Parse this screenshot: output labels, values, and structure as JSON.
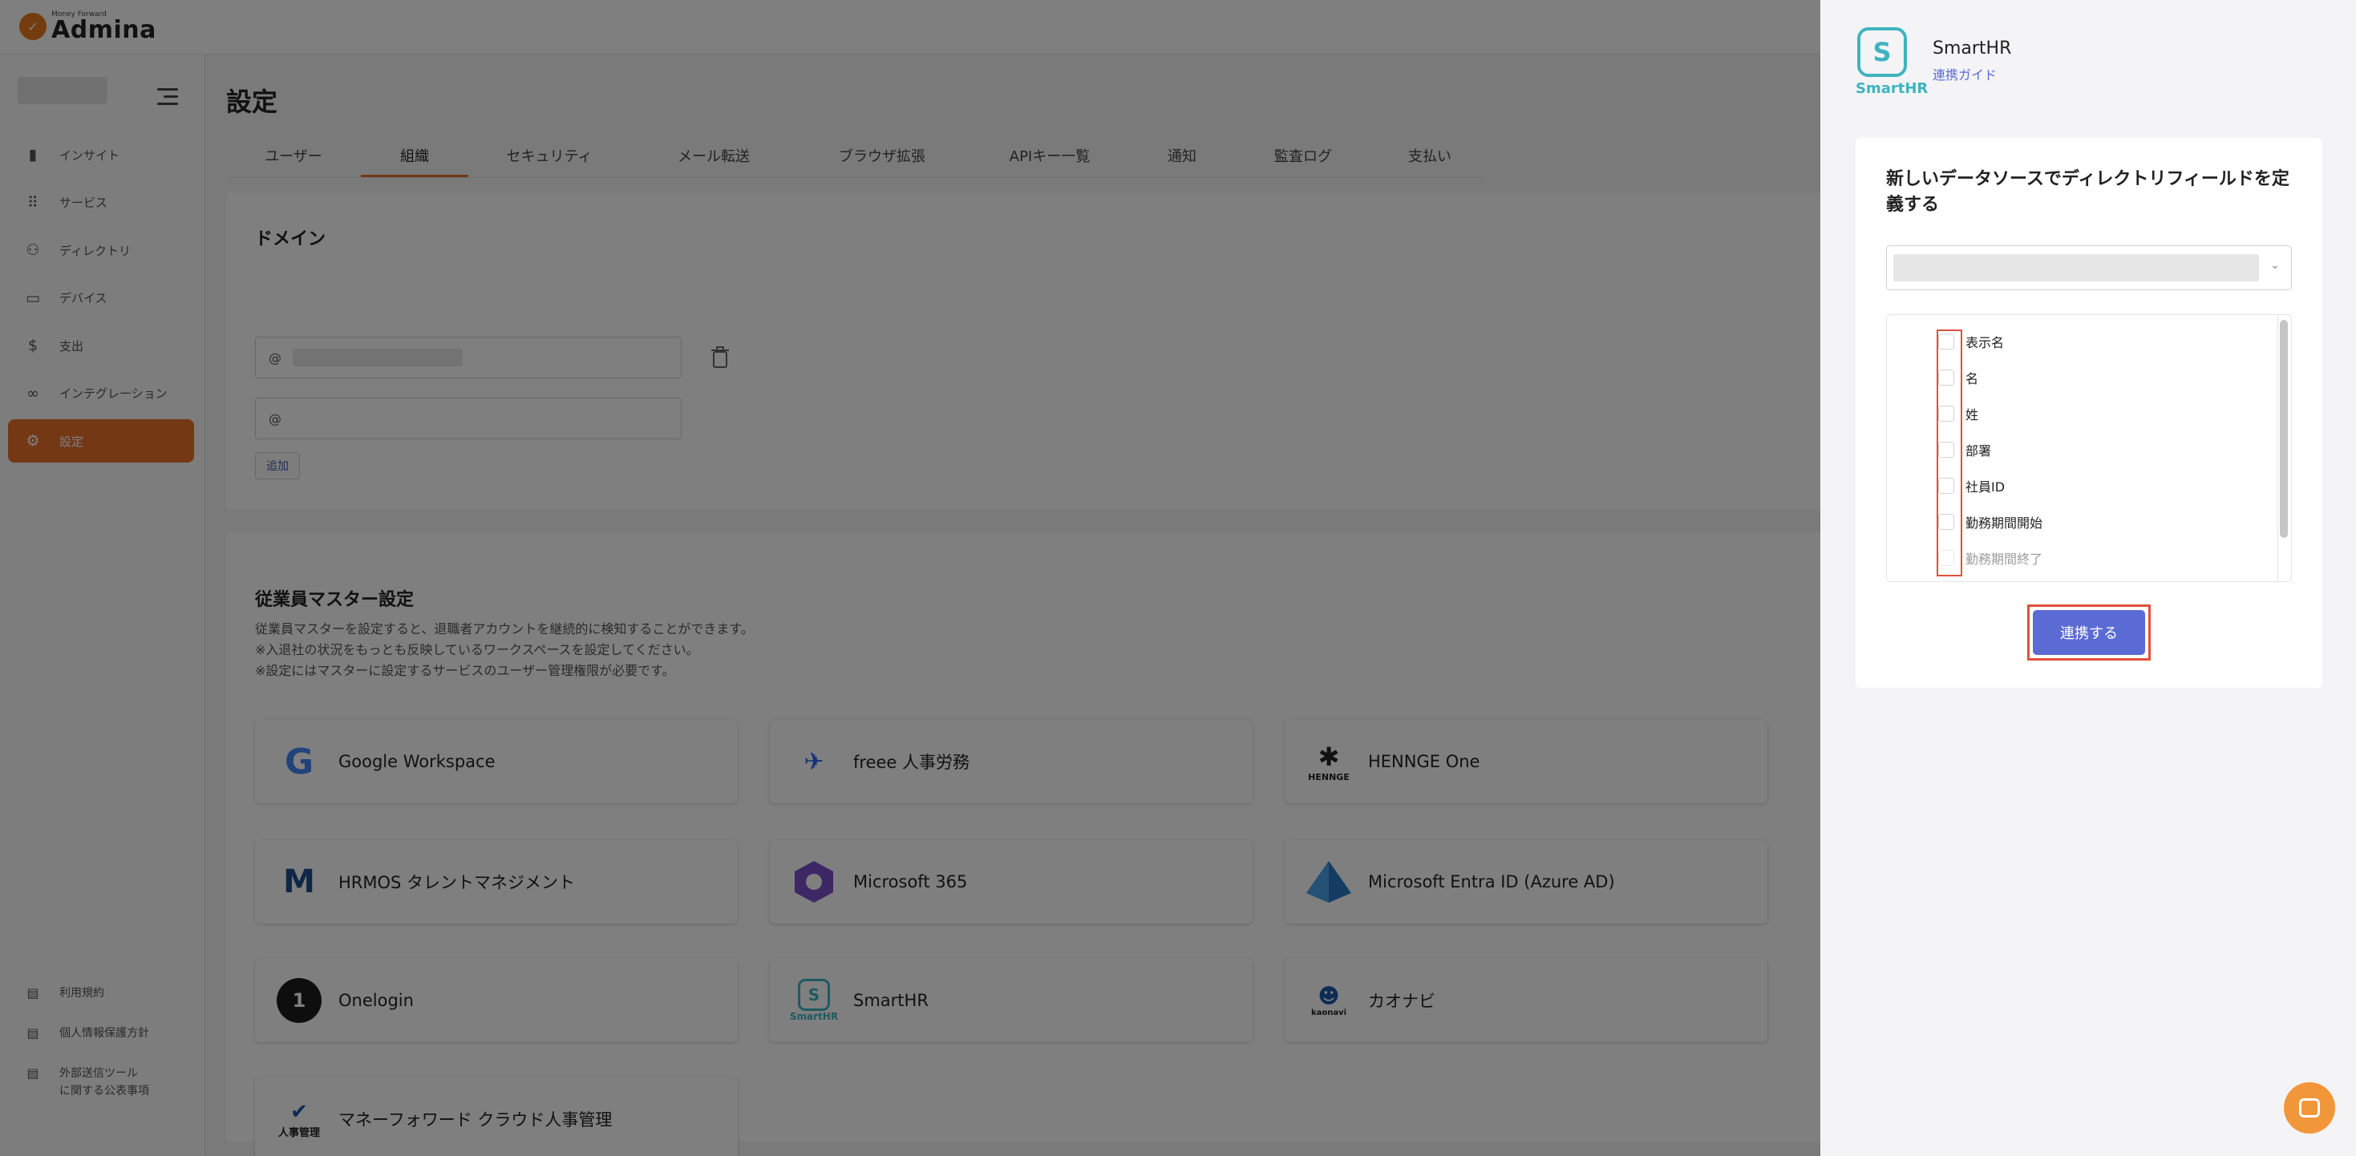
{
  "brand": {
    "sub": "Money Forward",
    "name": "Admina"
  },
  "sidebar": {
    "items": [
      {
        "label": "インサイト",
        "icon": "chart-bar-icon"
      },
      {
        "label": "サービス",
        "icon": "grid-icon"
      },
      {
        "label": "ディレクトリ",
        "icon": "users-icon"
      },
      {
        "label": "デバイス",
        "icon": "laptop-icon"
      },
      {
        "label": "支出",
        "icon": "dollar-icon"
      },
      {
        "label": "インテグレーション",
        "icon": "link-icon"
      },
      {
        "label": "設定",
        "icon": "gear-icon",
        "active": true
      }
    ],
    "footer": [
      {
        "label": "利用規約",
        "icon": "document-icon"
      },
      {
        "label": "個人情報保護方針",
        "icon": "document-icon"
      },
      {
        "label": "外部送信ツール\nに関する公表事項",
        "icon": "document-icon"
      }
    ]
  },
  "main": {
    "title": "設定",
    "tabs": [
      "ユーザー",
      "組織",
      "セキュリティ",
      "メール転送",
      "ブラウザ拡張",
      "APIキー一覧",
      "通知",
      "監査ログ",
      "支払い"
    ],
    "active_tab": "組織",
    "domain": {
      "title": "ドメイン",
      "at": "@",
      "add_label": "追加"
    },
    "master": {
      "title": "従業員マスター設定",
      "desc": [
        "従業員マスターを設定すると、退職者アカウントを継続的に検知することができます。",
        "※入退社の状況をもっとも反映しているワークスペースを設定してください。",
        "※設定にはマスターに設定するサービスのユーザー管理権限が必要です。"
      ],
      "services": [
        {
          "name": "Google Workspace",
          "icon": "google-logo-icon"
        },
        {
          "name": "freee 人事労務",
          "icon": "freee-logo-icon"
        },
        {
          "name": "HENNGE One",
          "icon": "hennge-logo-icon",
          "logo_text": "HENNGE"
        },
        {
          "name": "HRMOS タレントマネジメント",
          "icon": "hrmos-logo-icon"
        },
        {
          "name": "Microsoft 365",
          "icon": "microsoft365-logo-icon"
        },
        {
          "name": "Microsoft Entra ID (Azure AD)",
          "icon": "entra-logo-icon"
        },
        {
          "name": "Onelogin",
          "icon": "onelogin-logo-icon",
          "logo_text": "1"
        },
        {
          "name": "SmartHR",
          "icon": "smarthr-logo-icon",
          "logo_text": "SmartHR"
        },
        {
          "name": "カオナビ",
          "icon": "kaonavi-logo-icon",
          "logo_text": "kaonavi"
        },
        {
          "name": "マネーフォワード クラウド人事管理",
          "icon": "moneyforward-logo-icon",
          "logo_text": "人事管理"
        }
      ]
    }
  },
  "drawer": {
    "service_name": "SmartHR",
    "logo_text": "SmartHR",
    "guide_link": "連携ガイド",
    "heading": "新しいデータソースでディレクトリフィールドを定義する",
    "fields": [
      "表示名",
      "名",
      "姓",
      "部署",
      "社員ID",
      "勤務期間開始",
      "勤務期間終了"
    ],
    "connect_label": "連携する"
  },
  "colors": {
    "accent": "#e8702a",
    "primary": "#5b6bd4",
    "smarthr": "#3fb4c0",
    "highlight": "#e2503a"
  }
}
